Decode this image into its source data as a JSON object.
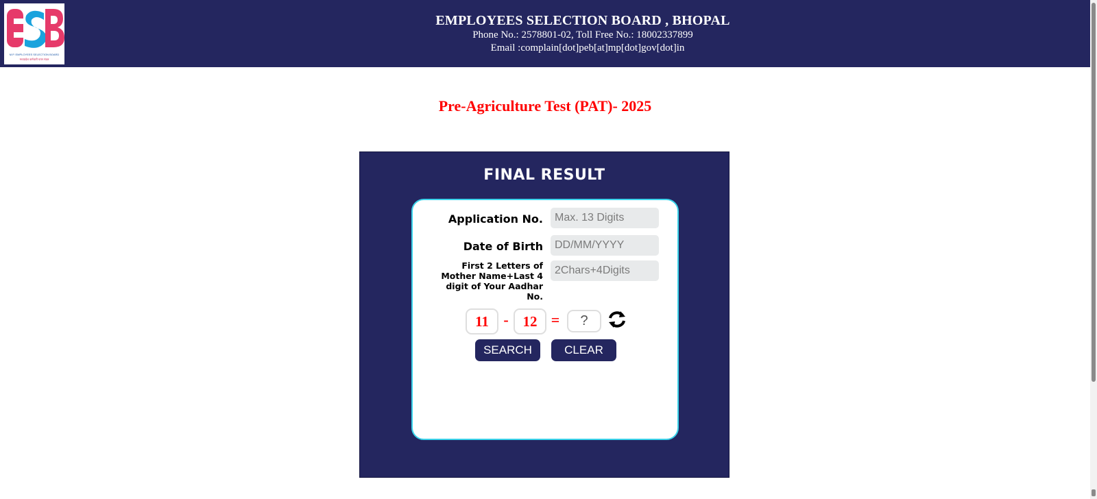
{
  "header": {
    "logo": {
      "mark": "ESB",
      "caption_en": "M.P. EMPLOYEES SELECTION BOARD",
      "caption_hi": "मध्यप्रदेश कर्मचारी चयन मंडल"
    },
    "org_name": "EMPLOYEES SELECTION BOARD , BHOPAL",
    "phone_line": "Phone No.: 2578801-02, Toll Free No.: 18002337899",
    "email_line": "Email :complain[dot]peb[at]mp[dot]gov[dot]in"
  },
  "exam_title": "Pre-Agriculture Test (PAT)- 2025",
  "result_panel": {
    "title": "FINAL RESULT",
    "fields": {
      "application_no": {
        "label": "Application No.",
        "placeholder": "Max. 13 Digits",
        "value": ""
      },
      "dob": {
        "label": "Date of Birth",
        "placeholder": "DD/MM/YYYY",
        "value": ""
      },
      "mother_aadhar": {
        "label": "First 2 Letters of Mother Name+Last 4 digit of Your Aadhar No.",
        "placeholder": "2Chars+4Digits",
        "value": ""
      }
    },
    "captcha": {
      "operand1": "11",
      "operator": "-",
      "operand2": "12",
      "equals": "=",
      "answer_placeholder": "?",
      "refresh_icon": "refresh-icon"
    },
    "buttons": {
      "search": "SEARCH",
      "clear": "CLEAR"
    }
  },
  "colors": {
    "navy": "#24265f",
    "title_red": "#ff0000",
    "card_border": "#3ad3ea",
    "input_bg": "#e8eaeb"
  }
}
